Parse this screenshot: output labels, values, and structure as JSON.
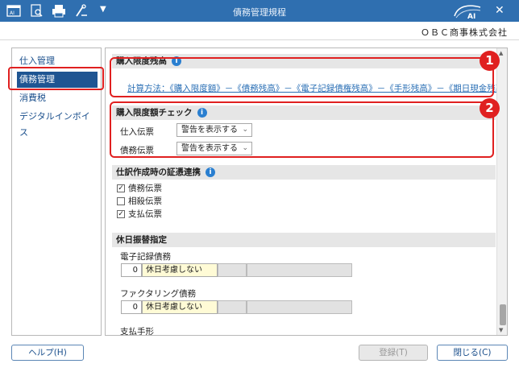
{
  "window": {
    "title": "債務管理規程",
    "logo_text": "AI",
    "close_glyph": "✕"
  },
  "company": "ＯＢＣ商事株式会社",
  "sidebar": {
    "items": [
      {
        "label": "仕入管理",
        "active": false
      },
      {
        "label": "債務管理",
        "active": true
      },
      {
        "label": "消費税",
        "active": false
      },
      {
        "label": "デジタルインボイス",
        "active": false
      }
    ]
  },
  "sections": {
    "limit_balance": {
      "title": "購入限度残高",
      "formula": "計算方法：《購入限度額》－《債務残高》－《電子記録債権残高》－《手形残高》－《期日現金残高》"
    },
    "limit_check": {
      "title": "購入限度額チェック",
      "rows": [
        {
          "label": "仕入伝票",
          "value": "警告を表示する"
        },
        {
          "label": "債務伝票",
          "value": "警告を表示する"
        }
      ]
    },
    "journal_link": {
      "title": "仕訳作成時の証憑連携",
      "checks": [
        {
          "label": "債務伝票",
          "checked": true
        },
        {
          "label": "相殺伝票",
          "checked": false
        },
        {
          "label": "支払伝票",
          "checked": true
        }
      ]
    },
    "holiday": {
      "title": "休日振替指定",
      "items": [
        {
          "label": "電子記録債務",
          "code": "0",
          "value": "休日考慮しない"
        },
        {
          "label": "ファクタリング債務",
          "code": "0",
          "value": "休日考慮しない"
        },
        {
          "label": "支払手形"
        }
      ]
    }
  },
  "info_glyph": "i",
  "check_glyph": "✓",
  "chevron_glyph": "⌄",
  "badges": [
    "1",
    "2"
  ],
  "buttons": {
    "help": "ヘルプ(H)",
    "register": "登録(T)",
    "close": "閉じる(C)"
  },
  "colors": {
    "titlebar": "#2f6fb0",
    "sidebar_active": "#1f5592",
    "highlight": "#e02020",
    "link": "#2a6fb5"
  }
}
